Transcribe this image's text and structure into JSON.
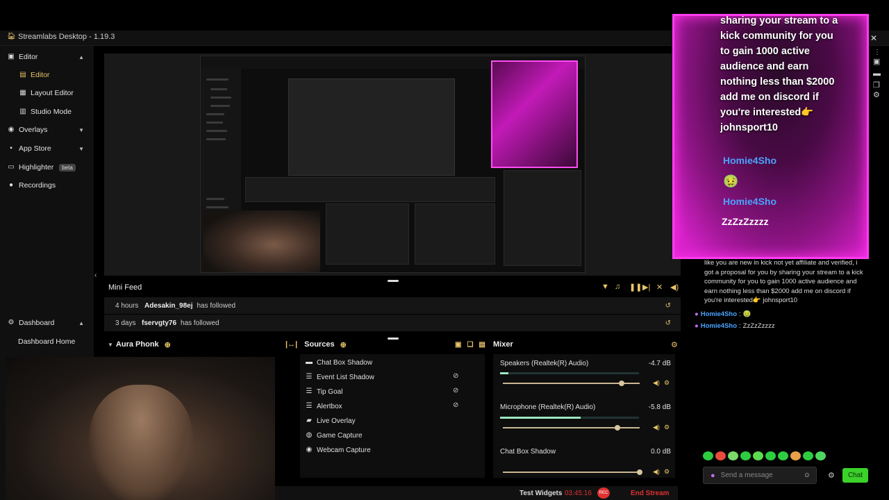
{
  "app": {
    "title": "Streamlabs Desktop - 1.19.3"
  },
  "sidebar": {
    "items": [
      {
        "label": "Editor",
        "icon": "editor-icon"
      },
      {
        "label": "Editor",
        "icon": "editor-sub-icon"
      },
      {
        "label": "Layout Editor",
        "icon": "layout-icon"
      },
      {
        "label": "Studio Mode",
        "icon": "studio-icon"
      },
      {
        "label": "Overlays",
        "icon": "overlays-icon"
      },
      {
        "label": "App Store",
        "icon": "app-store-icon"
      },
      {
        "label": "Highlighter",
        "icon": "highlighter-icon",
        "badge": "beta"
      },
      {
        "label": "Recordings",
        "icon": "recordings-icon"
      },
      {
        "label": "Dashboard",
        "icon": "dashboard-icon"
      },
      {
        "label": "Dashboard Home",
        "icon": ""
      }
    ]
  },
  "overlay": {
    "message": "sharing your stream to a kick community for you to gain 1000 active audience and earn nothing less than $2000 add me on discord if you're interested👉 johnsport10",
    "user1": "Homie4Sho",
    "emoji1": "🤢",
    "user2": "Homie4Sho",
    "msg2": "ZzZzZzzzz"
  },
  "chat": {
    "message": "like you are new in kick not yet affiliate and verified, i got a proposal for you by sharing your stream to a kick community for you to gain 1000 active audience and earn nothing less than $2000 add me on discord if you're interested👉 johnsport10",
    "lines": [
      {
        "user": "Homie4Sho",
        "text": "🤢"
      },
      {
        "user": "Homie4Sho",
        "text": "ZzZzZzzzz"
      }
    ],
    "input_placeholder": "Send a message",
    "send_label": "Chat"
  },
  "minifeed": {
    "title": "Mini Feed",
    "rows": [
      {
        "time": "4 hours",
        "user": "Adesakin_98ej",
        "action": "has followed"
      },
      {
        "time": "3 days",
        "user": "fservgty76",
        "action": "has followed"
      }
    ]
  },
  "scenes": {
    "title": "Aura Phonk"
  },
  "sources": {
    "title": "Sources",
    "items": [
      "Chat Box Shadow",
      "Event List Shadow",
      "Tip Goal",
      "Alertbox",
      "Live Overlay",
      "Game Capture",
      "Webcam Capture"
    ]
  },
  "mixer": {
    "title": "Mixer",
    "channels": [
      {
        "name": "Speakers (Realtek(R) Audio)",
        "db": "-4.7 dB",
        "level": 0.06,
        "volume": 0.87
      },
      {
        "name": "Microphone (Realtek(R) Audio)",
        "db": "-5.8 dB",
        "level": 0.58,
        "volume": 0.84
      },
      {
        "name": "Chat Box Shadow",
        "db": "0.0 dB",
        "level": 0.0,
        "volume": 1.0
      }
    ]
  },
  "footer": {
    "test_widgets": "Test Widgets",
    "timer": "03:45:16",
    "rec": "REC",
    "end_stream": "End Stream"
  },
  "colors": {
    "accent": "#ff3cf0",
    "green": "#3bd22a",
    "gold": "#cbb791",
    "red": "#e03131"
  }
}
